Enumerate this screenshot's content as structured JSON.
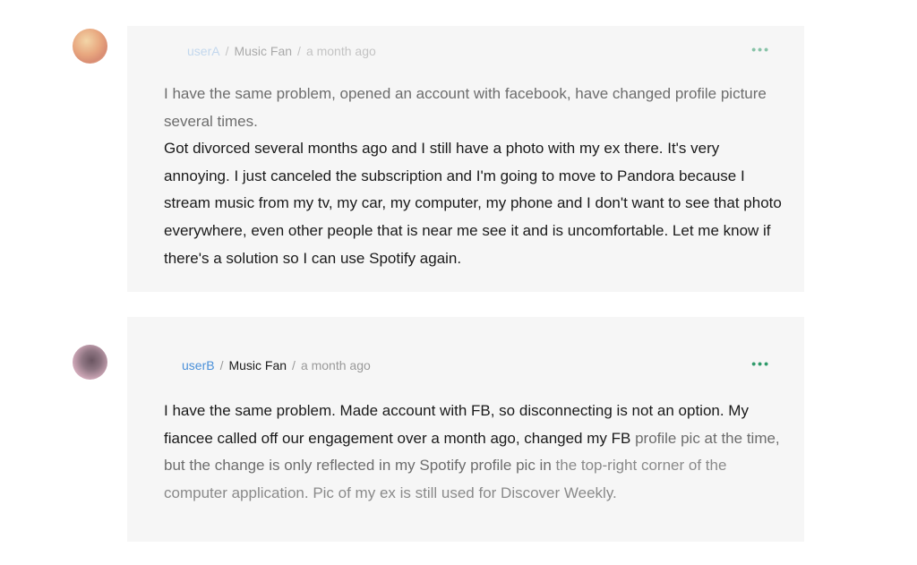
{
  "comments": [
    {
      "username": "userA",
      "role": "Music Fan",
      "time": "a month ago",
      "more": "•••",
      "paragraph1": "I have the same problem, opened an account with facebook, have changed profile picture several times.",
      "paragraph2": "Got divorced several months ago and I still have a photo with my ex there. It's very annoying. I just canceled the subscription and I'm going to move to Pandora because I stream music from my tv, my car, my computer, my phone and I don't want to see that photo everywhere, even other people that is near me see it and is uncomfortable. Let me know if there's a solution so I can use Spotify again."
    },
    {
      "username": "userB",
      "role": "Music Fan",
      "time": "a month ago",
      "more": "•••",
      "body_part1": "I have the same problem. Made account with FB, so disconnecting is not an option. My fiancee called off our engagement over a month ago, changed my FB ",
      "body_part2": "profile pic at the time, but the change is only reflected in my Spotify profile pic in ",
      "body_part3": "the top-right corner of the computer application. Pic of my ex is still used for Discover Weekly."
    }
  ]
}
